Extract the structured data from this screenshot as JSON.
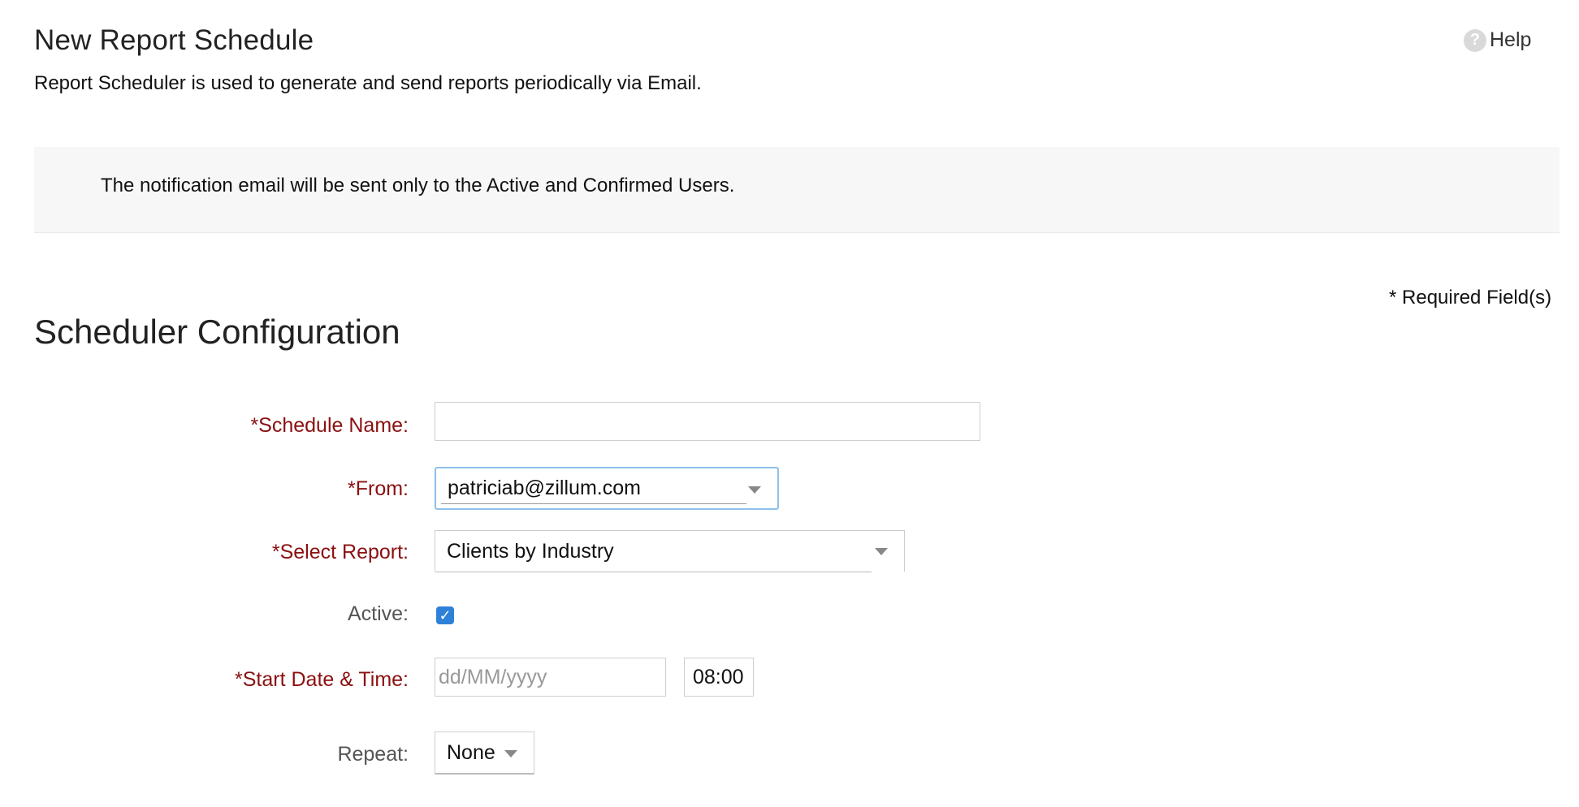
{
  "header": {
    "title": "New Report Schedule",
    "subtitle": "Report Scheduler is used to generate and send reports periodically via Email.",
    "help_label": "Help",
    "help_icon": "help-circle-icon"
  },
  "notice": {
    "text": "The notification email will be sent only to the Active and Confirmed Users."
  },
  "required_note": "* Required Field(s)",
  "section_title": "Scheduler Configuration",
  "form": {
    "schedule_name": {
      "label": "*Schedule Name:",
      "value": "",
      "placeholder": ""
    },
    "from": {
      "label": "*From:",
      "value": "patriciab@zillum.com"
    },
    "select_report": {
      "label": "*Select Report:",
      "value": "Clients by Industry"
    },
    "active": {
      "label": "Active:",
      "checked": true,
      "check_glyph": "✓"
    },
    "start_date_time": {
      "label": "*Start Date & Time:",
      "date_placeholder": "dd/MM/yyyy",
      "time_value": "08:00"
    },
    "repeat": {
      "label": "Repeat:",
      "value": "None"
    }
  },
  "colors": {
    "required_label": "#8b1010",
    "checkbox": "#2f80d8",
    "focus_border": "#8fc0ec"
  }
}
